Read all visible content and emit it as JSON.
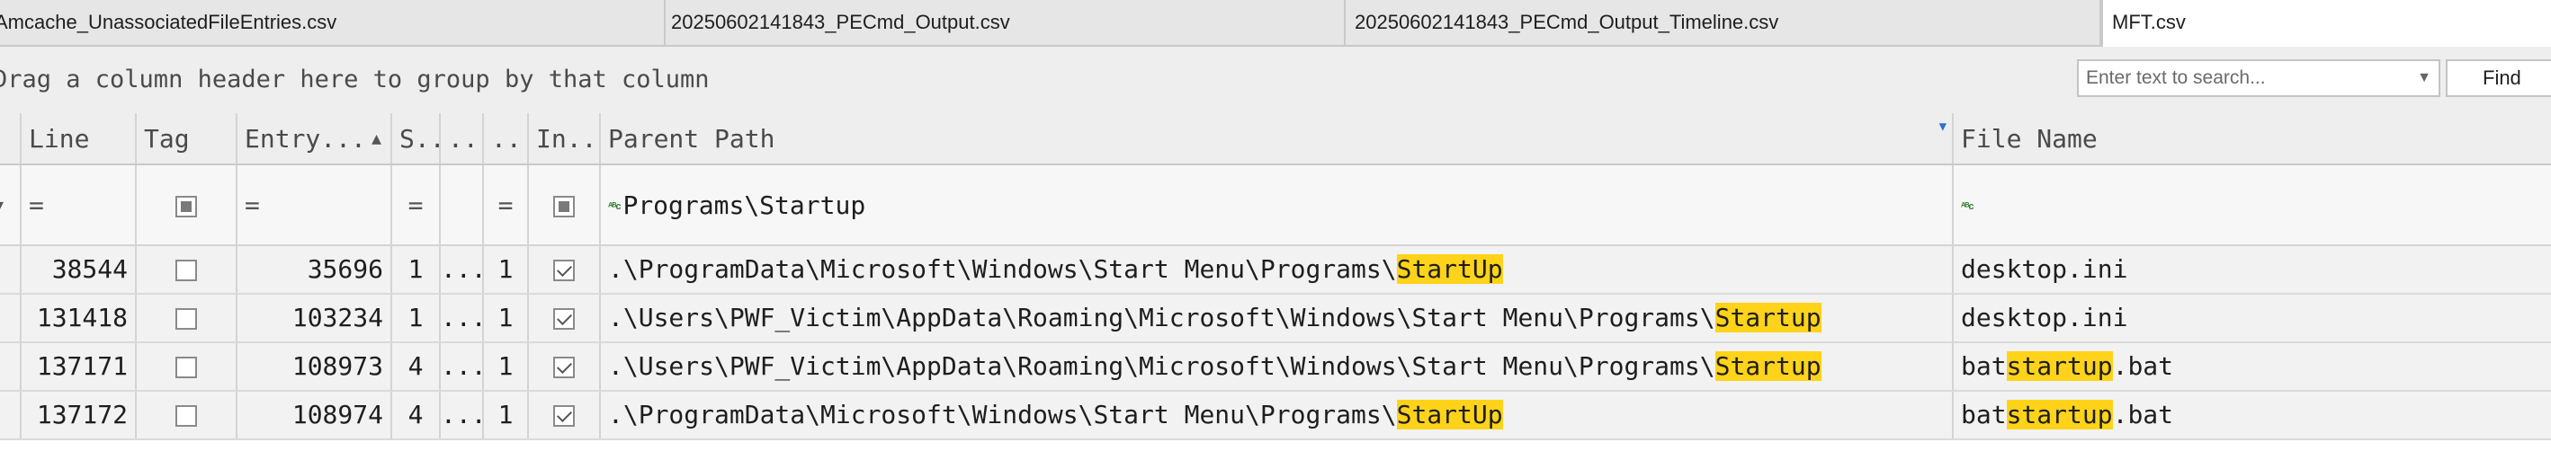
{
  "tabs": [
    {
      "label": "Amcache_UnassociatedFileEntries.csv"
    },
    {
      "label": "20250602141843_PECmd_Output.csv"
    },
    {
      "label": "20250602141843_PECmd_Output_Timeline.csv"
    },
    {
      "label": "MFT.csv"
    }
  ],
  "group_panel": {
    "hint": "Drag a column header here to group by that column",
    "search_placeholder": "Enter text to search...",
    "find_label": "Find"
  },
  "columns": {
    "line": "Line",
    "tag": "Tag",
    "entry": "Entry...",
    "seq": "S...",
    "c5": "...",
    "c6": "...",
    "in_use": "In...",
    "parent_path": "Parent Path",
    "file_name": "File Name"
  },
  "filter_row": {
    "line": "=",
    "entry": "=",
    "seq": "=",
    "c6": "=",
    "parent_path": "Programs\\Startup",
    "file_name": ""
  },
  "rows": [
    {
      "line": "38544",
      "entry": "35696",
      "seq": "1",
      "c5": "...",
      "c6": "1",
      "tag": false,
      "in_use": true,
      "path_pre": ".\\ProgramData\\Microsoft\\Windows\\Start Menu\\Programs\\",
      "path_hl": "StartUp",
      "path_post": "",
      "file_pre": "desktop.ini",
      "file_hl": "",
      "file_post": ""
    },
    {
      "line": "131418",
      "entry": "103234",
      "seq": "1",
      "c5": "...",
      "c6": "1",
      "tag": false,
      "in_use": true,
      "path_pre": ".\\Users\\PWF_Victim\\AppData\\Roaming\\Microsoft\\Windows\\Start Menu\\Programs\\",
      "path_hl": "Startup",
      "path_post": "",
      "file_pre": "desktop.ini",
      "file_hl": "",
      "file_post": ""
    },
    {
      "line": "137171",
      "entry": "108973",
      "seq": "4",
      "c5": "...",
      "c6": "1",
      "tag": false,
      "in_use": true,
      "path_pre": ".\\Users\\PWF_Victim\\AppData\\Roaming\\Microsoft\\Windows\\Start Menu\\Programs\\",
      "path_hl": "Startup",
      "path_post": "",
      "file_pre": "bat",
      "file_hl": "startup",
      "file_post": ".bat"
    },
    {
      "line": "137172",
      "entry": "108974",
      "seq": "4",
      "c5": "...",
      "c6": "1",
      "tag": false,
      "in_use": true,
      "path_pre": ".\\ProgramData\\Microsoft\\Windows\\Start Menu\\Programs\\",
      "path_hl": "StartUp",
      "path_post": "",
      "file_pre": "bat",
      "file_hl": "startup",
      "file_post": ".bat"
    }
  ],
  "colors": {
    "highlight": "#ffd319",
    "abc_icon": "#2e7d32",
    "filter_mark": "#2f6fd0"
  },
  "icons": {
    "sort": "sort-ascending-icon",
    "filter": "filter-icon",
    "text_filter": "abc-text-filter-icon",
    "dropdown": "chevron-down-icon"
  }
}
